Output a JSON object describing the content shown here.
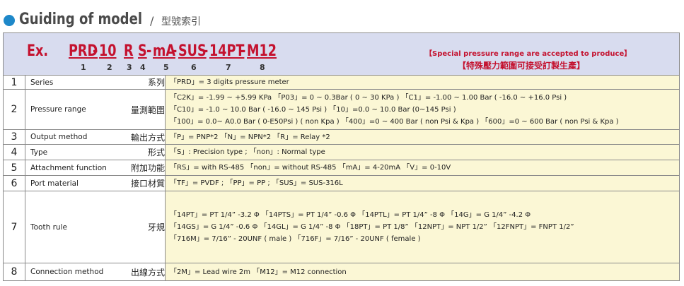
{
  "header": {
    "title_en": "Guiding of model",
    "separator": "/",
    "title_zh": "型號索引"
  },
  "example": {
    "label": "Ex.",
    "code_parts": [
      "PRD",
      "-",
      "10",
      "R",
      "S",
      "-",
      "mA",
      "-",
      "SUS",
      "-",
      "14PT",
      "-",
      "M12"
    ],
    "positions": [
      "1",
      "2",
      "3",
      "4",
      "5",
      "6",
      "7",
      "8"
    ],
    "note_en": "【Special pressure range are accepted to produce】",
    "note_zh": "【特殊壓力範圍可接受訂製生產】"
  },
  "rows": [
    {
      "num": "1",
      "label_en": "Series",
      "label_zh": "系列",
      "lines": [
        "「PRD」= 3 digits pressure meter"
      ]
    },
    {
      "num": "2",
      "label_en": "Pressure range",
      "label_zh": "量測範圍",
      "lines": [
        "「C2K」= -1.99 ~ +5.99 KPa 「P03」= 0 ~ 0.3Bar ( 0 ~ 30 KPa ) 「C1」= -1.00 ~ 1.00 Bar ( -16.0 ~ +16.0 Psi )",
        "「C10」= -1.0 ~ 10.0 Bar ( -16.0 ~ 145 Psi ) 「10」=0.0 ~ 10.0 Bar (0~145 Psi )",
        "「100」= 0.0~ A0.0 Bar ( 0-E50Psi ) ( non Kpa ) 「400」=0 ~ 400 Bar ( non Psi & Kpa ) 「600」=0 ~ 600 Bar ( non Psi & Kpa )"
      ]
    },
    {
      "num": "3",
      "label_en": "Output method",
      "label_zh": "輸出方式",
      "lines": [
        "「P」= PNP*2 「N」= NPN*2 「R」= Relay *2"
      ]
    },
    {
      "num": "4",
      "label_en": "Type",
      "label_zh": "形式",
      "lines": [
        "「S」: Precision type ; 「non」: Normal type"
      ]
    },
    {
      "num": "5",
      "label_en": "Attachment function",
      "label_zh": "附加功能",
      "lines": [
        "「RS」= with RS-485 「non」= without RS-485 「mA」= 4-20mA 「V」= 0-10V"
      ]
    },
    {
      "num": "6",
      "label_en": "Port material",
      "label_zh": "接口材質",
      "lines": [
        "「TF」= PVDF ; 「PP」= PP ; 「SUS」= SUS-316L"
      ]
    },
    {
      "num": "7",
      "label_en": "Tooth rule",
      "label_zh": "牙規",
      "lines": [
        "「14PT」= PT 1/4” -3.2 Φ 「14PTS」= PT 1/4” -0.6 Φ 「14PTL」= PT 1/4” -8 Φ 「14G」= G 1/4” -4.2 Φ",
        "「14GS」= G 1/4” -0.6 Φ 「14GL」= G 1/4” -8 Φ 「18PT」= PT 1/8” 「12NPT」= NPT 1/2” 「12FNPT」= FNPT 1/2”",
        "「716M」= 7/16” - 20UNF ( male ) 「716F」= 7/16” - 20UNF ( female )"
      ]
    },
    {
      "num": "8",
      "label_en": "Connection method",
      "label_zh": "出線方式",
      "lines": [
        "「2M」= Lead wire 2m 「M12」= M12 connection"
      ]
    }
  ],
  "colors": {
    "accent_red": "#c4122f",
    "title_dot_blue": "#1e88c9",
    "example_band": "#d8dcef",
    "value_cell": "#fbf7d5"
  }
}
